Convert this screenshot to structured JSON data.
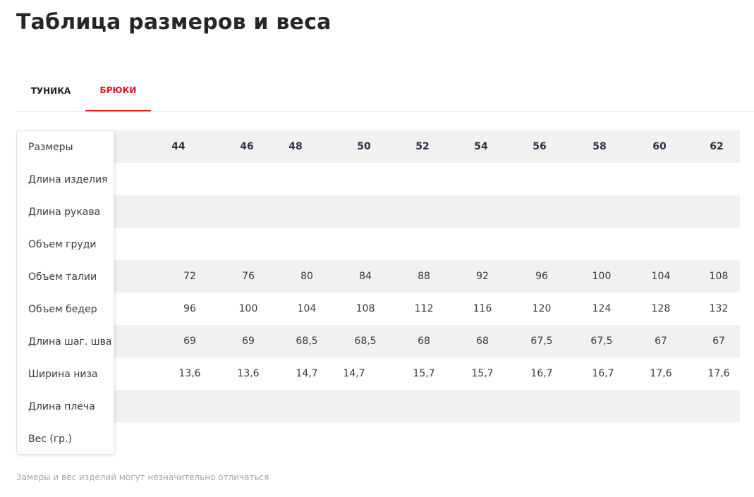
{
  "page": {
    "title": "Таблица размеров и веса",
    "note": "Замеры и вес изделий могут незначительно отличаться"
  },
  "tabs": [
    {
      "label": "ТУНИКА",
      "active": false
    },
    {
      "label": "БРЮКИ",
      "active": true
    }
  ],
  "colors": {
    "accent": "#e3131b",
    "row_shade": "#f1f1f1"
  },
  "table": {
    "row_labels": [
      "Размеры",
      "Длина изделия",
      "Длина рукава",
      "Объем груди",
      "Объем талии",
      "Объем бедер",
      "Длина шаг. шва",
      "Ширина низа",
      "Длина плеча",
      "Вес (гр.)"
    ],
    "sizes": [
      "44",
      "46",
      "48",
      "50",
      "52",
      "54",
      "56",
      "58",
      "60",
      "62"
    ],
    "rows": [
      [],
      [],
      [],
      [
        "72",
        "76",
        "80",
        "84",
        "88",
        "92",
        "96",
        "100",
        "104",
        "108"
      ],
      [
        "96",
        "100",
        "104",
        "108",
        "112",
        "116",
        "120",
        "124",
        "128",
        "132"
      ],
      [
        "69",
        "69",
        "68,5",
        "68,5",
        "68",
        "68",
        "67,5",
        "67,5",
        "67",
        "67"
      ],
      [
        "13,6",
        "13,6",
        "14,7",
        "14,7",
        "15,7",
        "15,7",
        "16,7",
        "16,7",
        "17,6",
        "17,6"
      ],
      [],
      []
    ]
  }
}
